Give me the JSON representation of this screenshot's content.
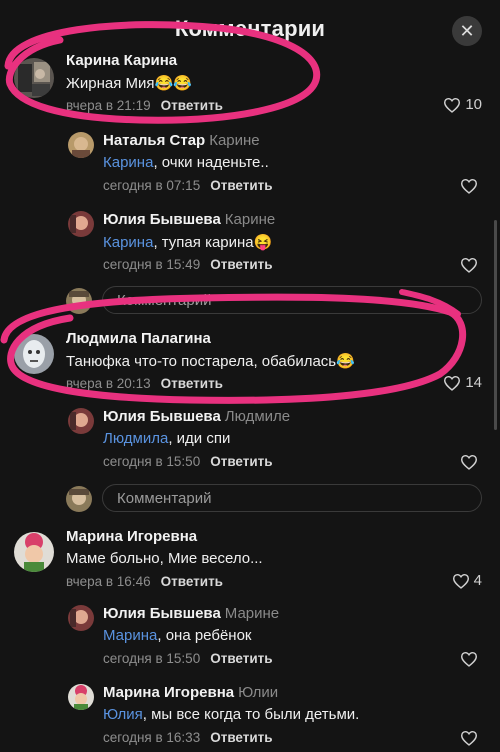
{
  "header": {
    "title": "Комментарии",
    "close_icon": "close-icon"
  },
  "reply_placeholder": "Комментарий",
  "comments": [
    {
      "author": "Карина Карина",
      "text": "Жирная Мия😂😂",
      "time": "вчера в 21:19",
      "reply_label": "Ответить",
      "likes": "10"
    },
    {
      "author": "Наталья Стар",
      "reply_to": "Карине",
      "mention": "Карина",
      "text": ", очки наденьте..",
      "time": "сегодня в 07:15",
      "reply_label": "Ответить",
      "likes": ""
    },
    {
      "author": "Юлия Бывшева",
      "reply_to": "Карине",
      "mention": "Карина",
      "text": ", тупая карина😝",
      "time": "сегодня в 15:49",
      "reply_label": "Ответить",
      "likes": ""
    },
    {
      "author": "Людмила Палагина",
      "text": "Танюфка что-то постарела, обабилась😂",
      "time": "вчера в 20:13",
      "reply_label": "Ответить",
      "likes": "14"
    },
    {
      "author": "Юлия Бывшева",
      "reply_to": "Людмиле",
      "mention": "Людмила",
      "text": ", иди спи",
      "time": "сегодня в 15:50",
      "reply_label": "Ответить",
      "likes": ""
    },
    {
      "author": "Марина Игоревна",
      "text": "Маме больно, Мие весело...",
      "time": "вчера в 16:46",
      "reply_label": "Ответить",
      "likes": "4"
    },
    {
      "author": "Юлия Бывшева",
      "reply_to": "Марине",
      "mention": "Марина",
      "text": ", она ребёнок",
      "time": "сегодня в 15:50",
      "reply_label": "Ответить",
      "likes": ""
    },
    {
      "author": "Марина Игоревна",
      "reply_to": "Юлии",
      "mention": "Юлия",
      "text": ", мы все когда то были детьми.",
      "time": "сегодня в 16:33",
      "reply_label": "Ответить",
      "likes": ""
    }
  ],
  "colors": {
    "background": "#141414",
    "mention": "#5a93e0",
    "highlight": "#e8317f"
  }
}
